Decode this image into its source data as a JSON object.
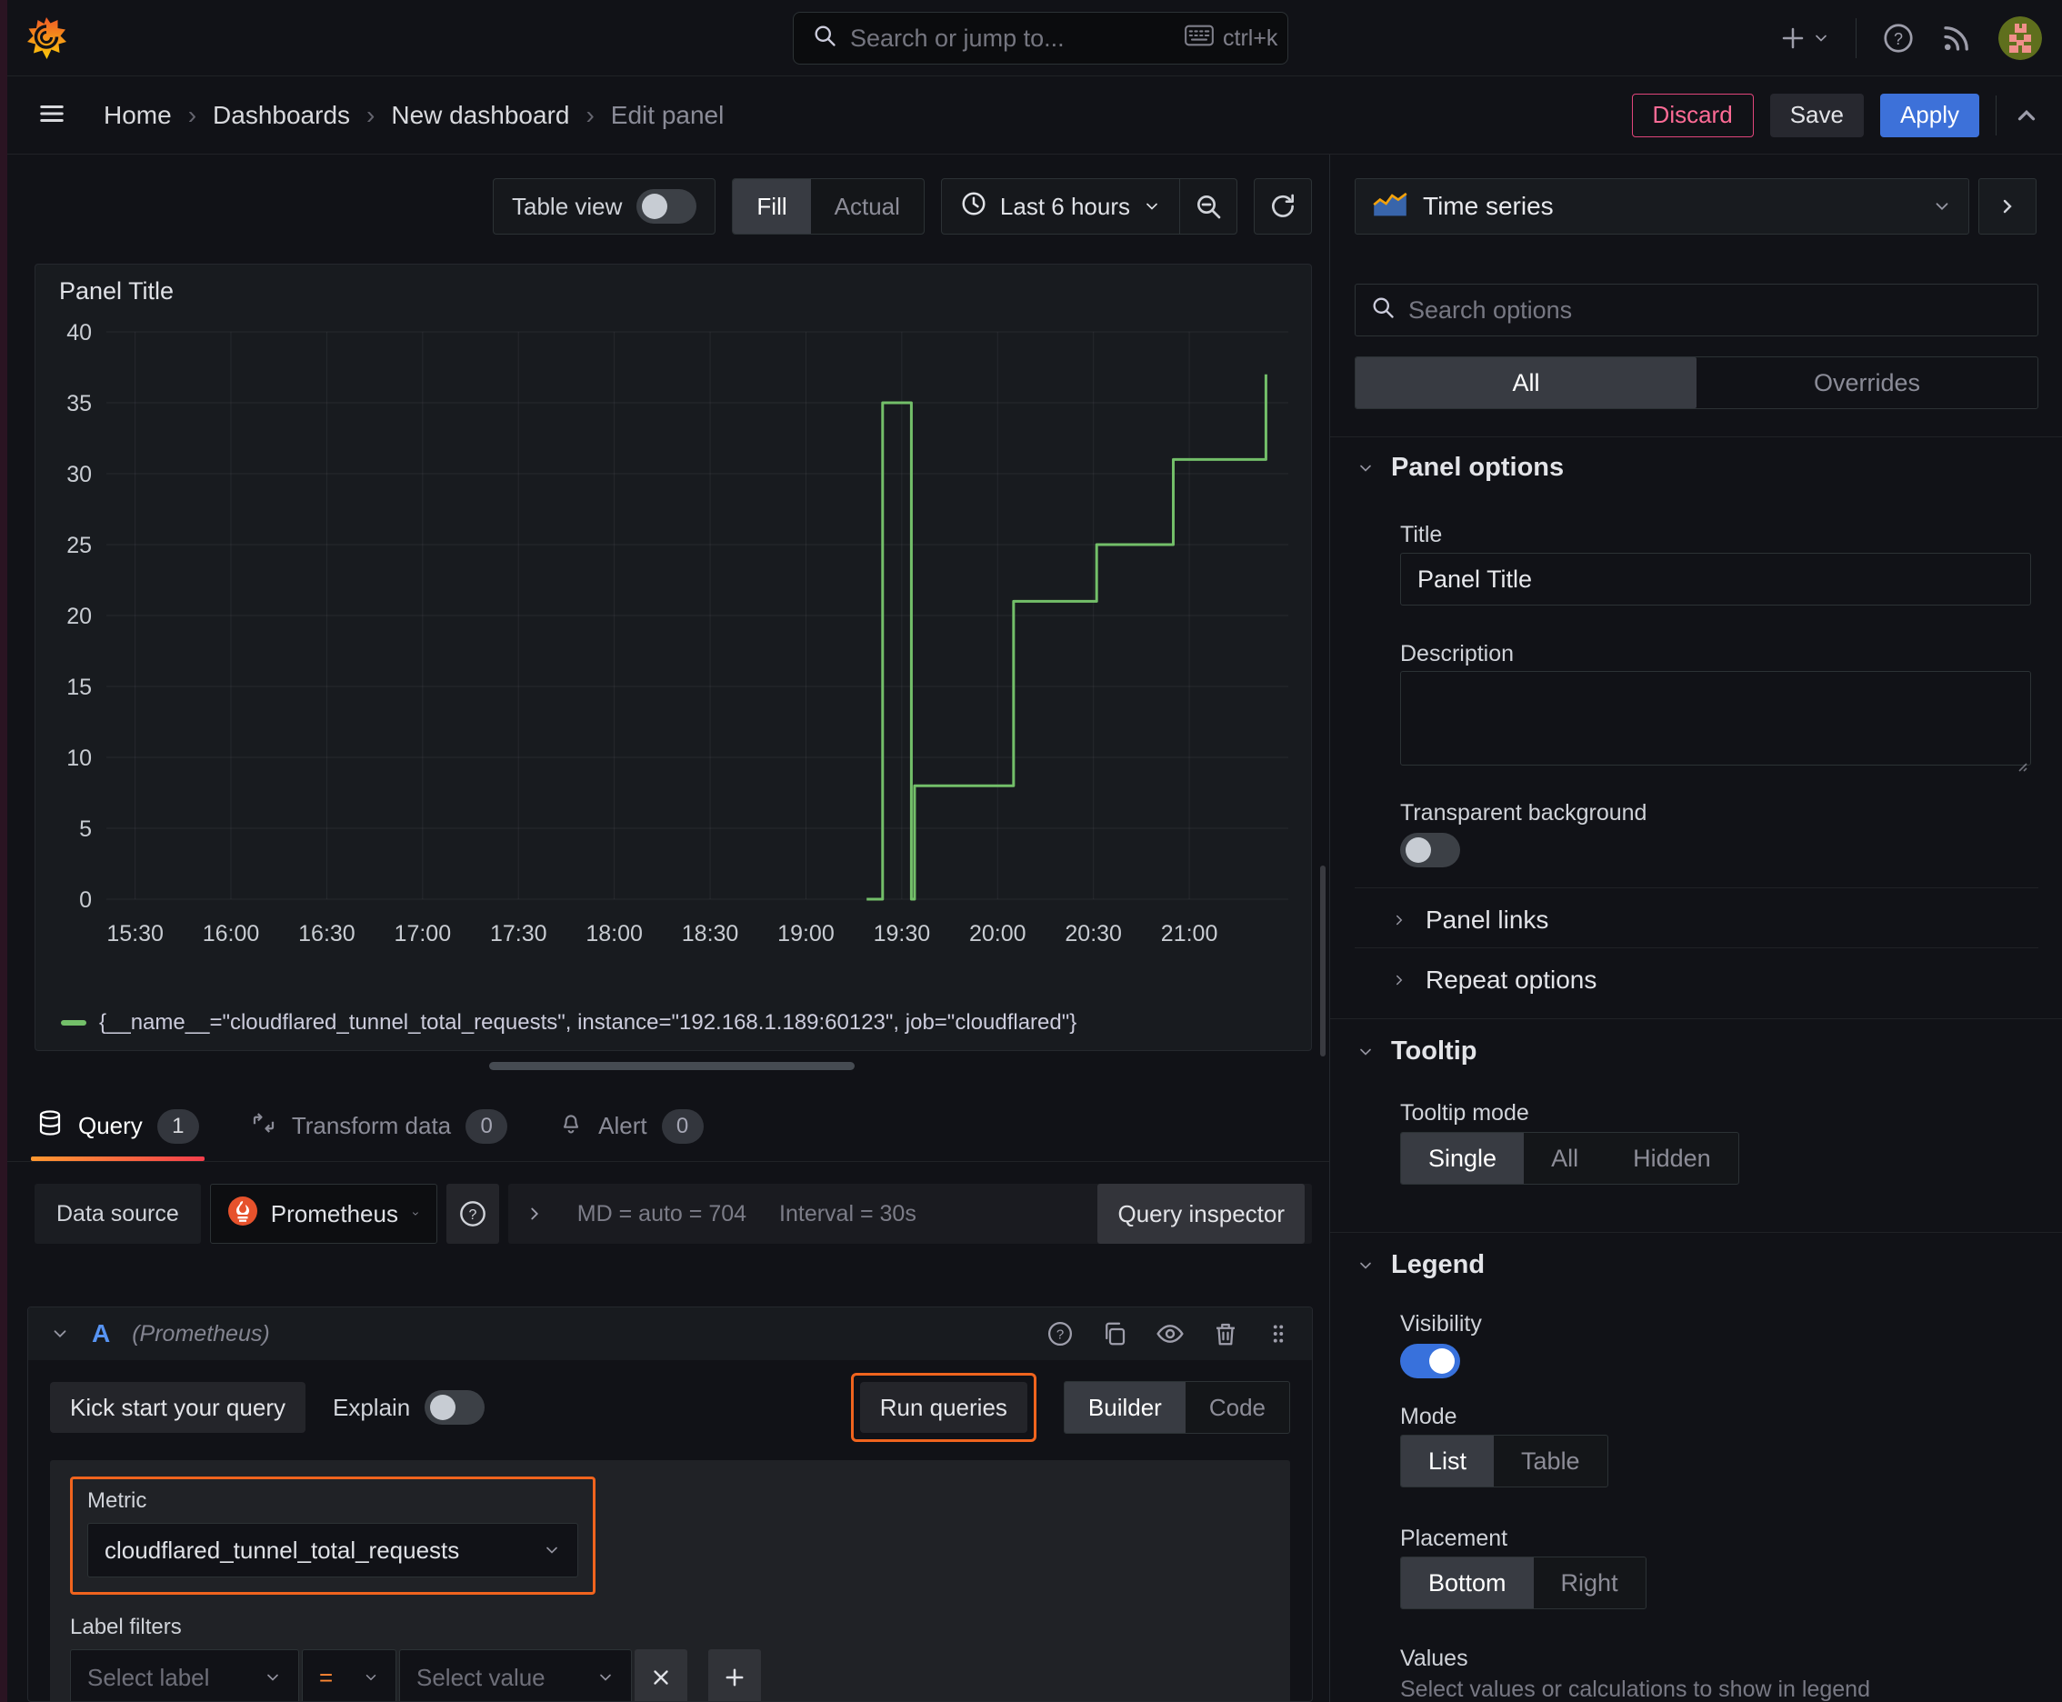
{
  "colors": {
    "accent_orange": "#ff8833",
    "annotation_orange": "#f0641e",
    "series_green": "#73bf69",
    "apply_blue": "#3d71d9",
    "discard_pink": "#e0457b",
    "toggle_on_blue": "#3871dc",
    "ref_id_blue": "#5794f2",
    "tab_underline": "linear-gradient(90deg,#ff9830,#f53e4c)"
  },
  "topbar": {
    "search_placeholder": "Search or jump to...",
    "shortcut": "ctrl+k"
  },
  "breadcrumb": {
    "items": [
      "Home",
      "Dashboards",
      "New dashboard",
      "Edit panel"
    ]
  },
  "header_actions": {
    "discard": "Discard",
    "save": "Save",
    "apply": "Apply"
  },
  "toolbar": {
    "table_view": "Table view",
    "fill": "Fill",
    "actual": "Actual",
    "time_range": "Last 6 hours"
  },
  "panel": {
    "title": "Panel Title"
  },
  "chart_data": {
    "type": "line",
    "title": "Panel Title",
    "x_domain": [
      "15:21",
      "21:31"
    ],
    "x_ticks": [
      "15:30",
      "16:00",
      "16:30",
      "17:00",
      "17:30",
      "18:00",
      "18:30",
      "19:00",
      "19:30",
      "20:00",
      "20:30",
      "21:00"
    ],
    "ylim": [
      0,
      40
    ],
    "y_ticks": [
      0,
      5,
      10,
      15,
      20,
      25,
      30,
      35,
      40
    ],
    "grid": true,
    "legend_position": "bottom",
    "series": [
      {
        "name": "{__name__=\"cloudflared_tunnel_total_requests\", instance=\"192.168.1.189:60123\", job=\"cloudflared\"}",
        "color": "#73bf69",
        "step": true,
        "points": [
          [
            "19:19",
            0
          ],
          [
            "19:24",
            35
          ],
          [
            "19:33",
            0
          ],
          [
            "19:34",
            8
          ],
          [
            "20:05",
            21
          ],
          [
            "20:31",
            25
          ],
          [
            "20:55",
            31
          ],
          [
            "21:24",
            37
          ]
        ]
      }
    ]
  },
  "tabs": [
    {
      "label": "Query",
      "count": "1"
    },
    {
      "label": "Transform data",
      "count": "0"
    },
    {
      "label": "Alert",
      "count": "0"
    }
  ],
  "datasource": {
    "label": "Data source",
    "name": "Prometheus",
    "stats_md": "MD = auto = 704",
    "stats_interval": "Interval = 30s",
    "inspector": "Query inspector"
  },
  "query": {
    "ref_id": "A",
    "ds_hint": "(Prometheus)",
    "kickstart": "Kick start your query",
    "explain": "Explain",
    "run": "Run queries",
    "builder": "Builder",
    "code": "Code",
    "metric_label": "Metric",
    "metric_value": "cloudflared_tunnel_total_requests",
    "filters_label": "Label filters",
    "select_label": "Select label",
    "operator": "=",
    "select_value": "Select value"
  },
  "options": {
    "viz_type": "Time series",
    "search_placeholder": "Search options",
    "tab_all": "All",
    "tab_overrides": "Overrides",
    "panel_options": {
      "header": "Panel options",
      "title_label": "Title",
      "title_value": "Panel Title",
      "description_label": "Description",
      "transparent_label": "Transparent background"
    },
    "collapsed": {
      "panel_links": "Panel links",
      "repeat_options": "Repeat options"
    },
    "tooltip": {
      "header": "Tooltip",
      "mode_label": "Tooltip mode",
      "modes": [
        "Single",
        "All",
        "Hidden"
      ]
    },
    "legend": {
      "header": "Legend",
      "visibility_label": "Visibility",
      "mode_label": "Mode",
      "modes": [
        "List",
        "Table"
      ],
      "placement_label": "Placement",
      "placements": [
        "Bottom",
        "Right"
      ],
      "values_label": "Values",
      "values_help": "Select values or calculations to show in legend"
    }
  }
}
